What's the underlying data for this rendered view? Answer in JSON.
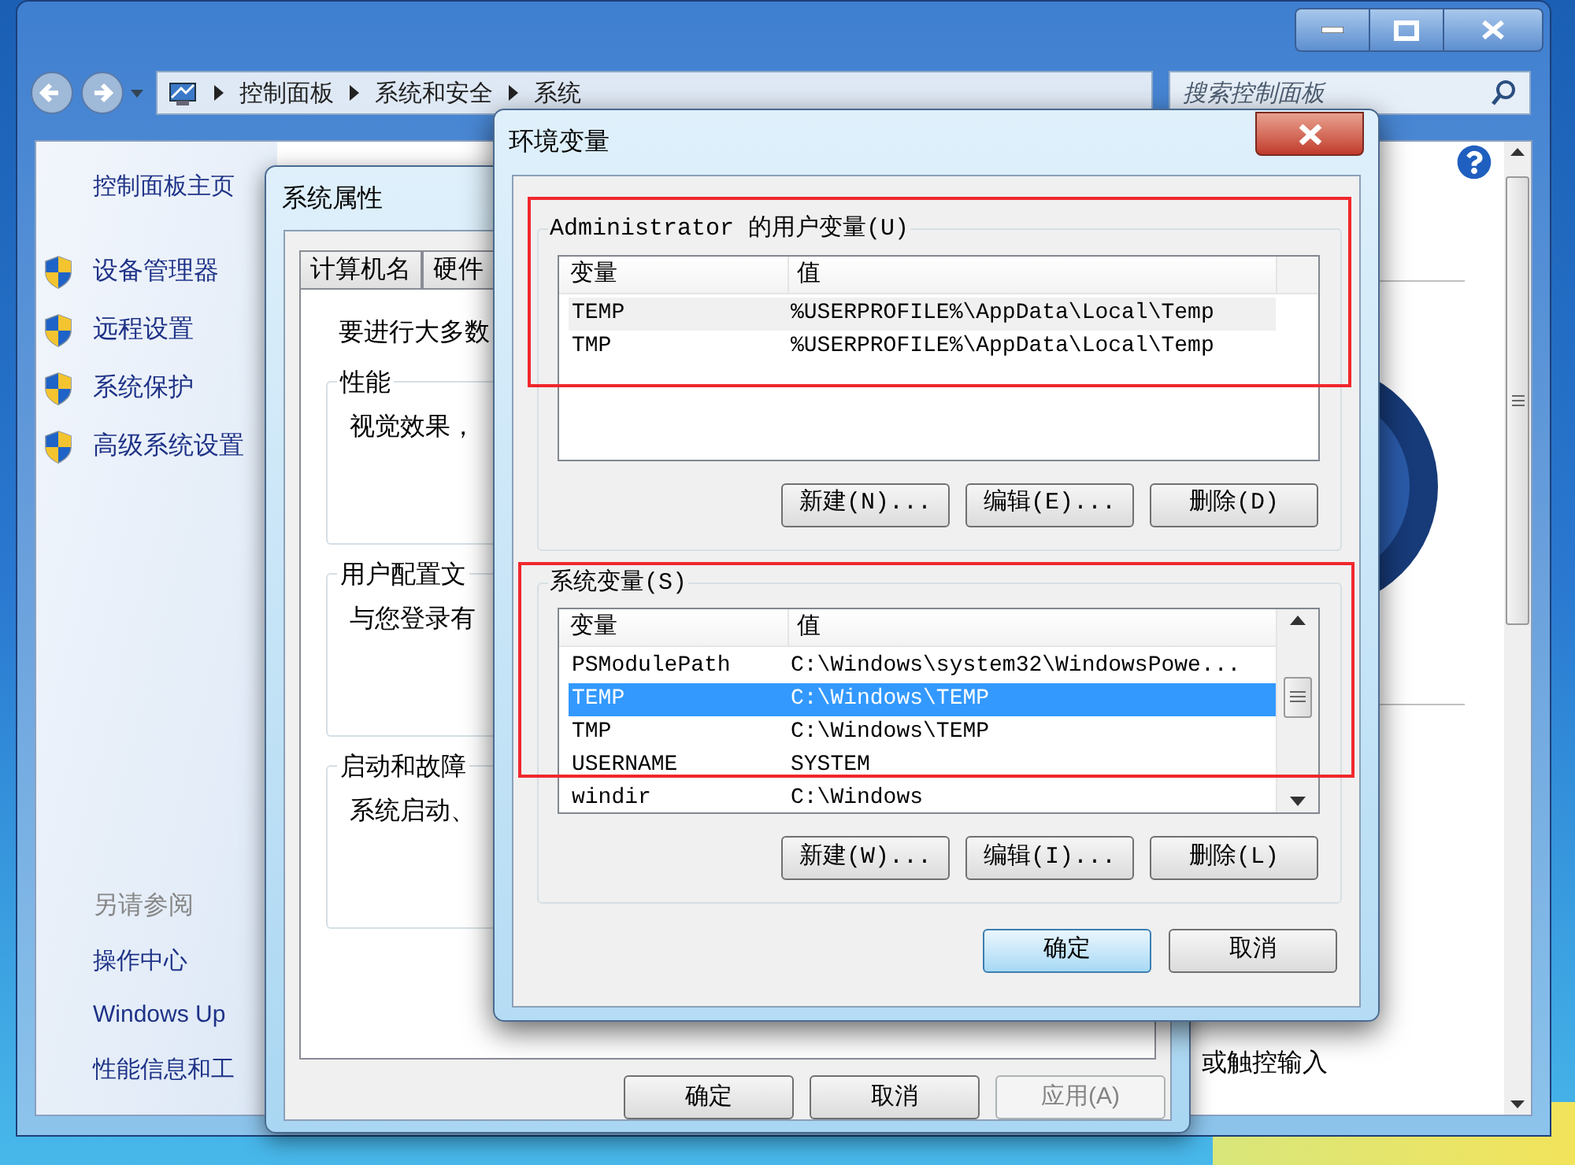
{
  "control_panel": {
    "breadcrumb": [
      "控制面板",
      "系统和安全",
      "系统"
    ],
    "search": {
      "placeholder": "搜索控制面板"
    },
    "sidebar": {
      "home": "控制面板主页",
      "tasks": [
        "设备管理器",
        "远程设置",
        "系统保护",
        "高级系统设置"
      ],
      "see_also_title": "另请参阅",
      "see_also": [
        "操作中心",
        "Windows Up",
        "性能信息和工"
      ]
    },
    "content_text": "或触控输入"
  },
  "system_properties": {
    "title": "系统属性",
    "tabs": [
      "计算机名",
      "硬件"
    ],
    "intro": "要进行大多数",
    "groups": [
      {
        "title": "性能",
        "text": "视觉效果，"
      },
      {
        "title": "用户配置文",
        "text": "与您登录有"
      },
      {
        "title": "启动和故障",
        "text": "系统启动、"
      }
    ],
    "buttons": [
      {
        "label": "确定",
        "disabled": false
      },
      {
        "label": "取消",
        "disabled": false
      },
      {
        "label": "应用(A)",
        "disabled": true
      }
    ]
  },
  "env_dialog": {
    "title": "环境变量",
    "user_vars": {
      "title": "Administrator 的用户变量(U)",
      "focused": false,
      "scrollbar": false,
      "columns": [
        "变量",
        "值"
      ],
      "rows": [
        {
          "name": "TEMP",
          "value": "%USERPROFILE%\\AppData\\Local\\Temp",
          "selected": true
        },
        {
          "name": "TMP",
          "value": "%USERPROFILE%\\AppData\\Local\\Temp",
          "selected": false
        }
      ],
      "buttons": [
        "新建(N)...",
        "编辑(E)...",
        "删除(D)"
      ]
    },
    "system_vars": {
      "title": "系统变量(S)",
      "focused": true,
      "scrollbar": true,
      "columns": [
        "变量",
        "值"
      ],
      "rows": [
        {
          "name": "PSModulePath",
          "value": "C:\\Windows\\system32\\WindowsPowe...",
          "selected": false
        },
        {
          "name": "TEMP",
          "value": "C:\\Windows\\TEMP",
          "selected": true
        },
        {
          "name": "TMP",
          "value": "C:\\Windows\\TEMP",
          "selected": false
        },
        {
          "name": "USERNAME",
          "value": "SYSTEM",
          "selected": false
        },
        {
          "name": "windir",
          "value": "C:\\Windows",
          "selected": false
        }
      ],
      "buttons": [
        "新建(W)...",
        "编辑(I)...",
        "删除(L)"
      ]
    },
    "buttons": [
      {
        "label": "确定",
        "default": true
      },
      {
        "label": "取消",
        "default": false
      }
    ]
  }
}
